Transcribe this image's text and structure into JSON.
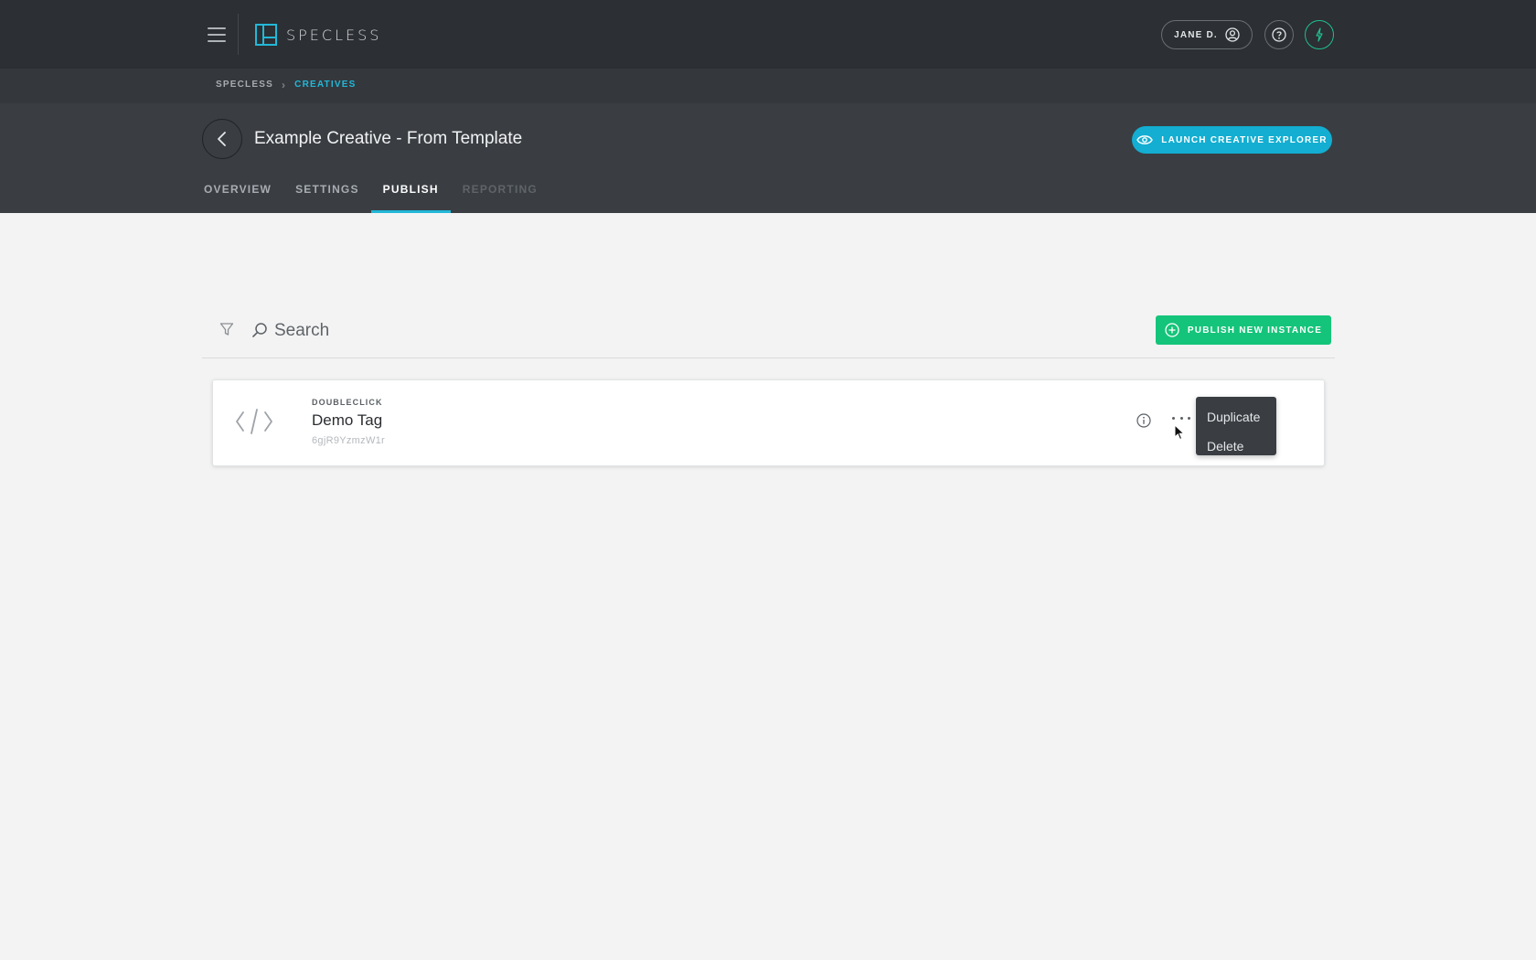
{
  "app": {
    "name": "SPECLESS"
  },
  "user": {
    "label": "JANE D."
  },
  "breadcrumb": {
    "root": "SPECLESS",
    "current": "CREATIVES"
  },
  "header": {
    "title": "Example Creative - From Template",
    "launch_label": "LAUNCH CREATIVE EXPLORER",
    "tabs": [
      {
        "label": "OVERVIEW",
        "state": "normal"
      },
      {
        "label": "SETTINGS",
        "state": "normal"
      },
      {
        "label": "PUBLISH",
        "state": "active"
      },
      {
        "label": "REPORTING",
        "state": "disabled"
      }
    ]
  },
  "toolbar": {
    "search_placeholder": "Search",
    "publish_label": "PUBLISH NEW INSTANCE"
  },
  "instances": [
    {
      "platform": "DOUBLECLICK",
      "name": "Demo Tag",
      "id": "6gjR9YzmzW1r",
      "icon": "code-icon"
    }
  ],
  "context_menu": {
    "items": [
      "Duplicate",
      "Delete"
    ]
  },
  "colors": {
    "accent": "#22b8d8",
    "launch": "#13aed1",
    "publish": "#14c47a",
    "topbar": "#2c2f33"
  }
}
